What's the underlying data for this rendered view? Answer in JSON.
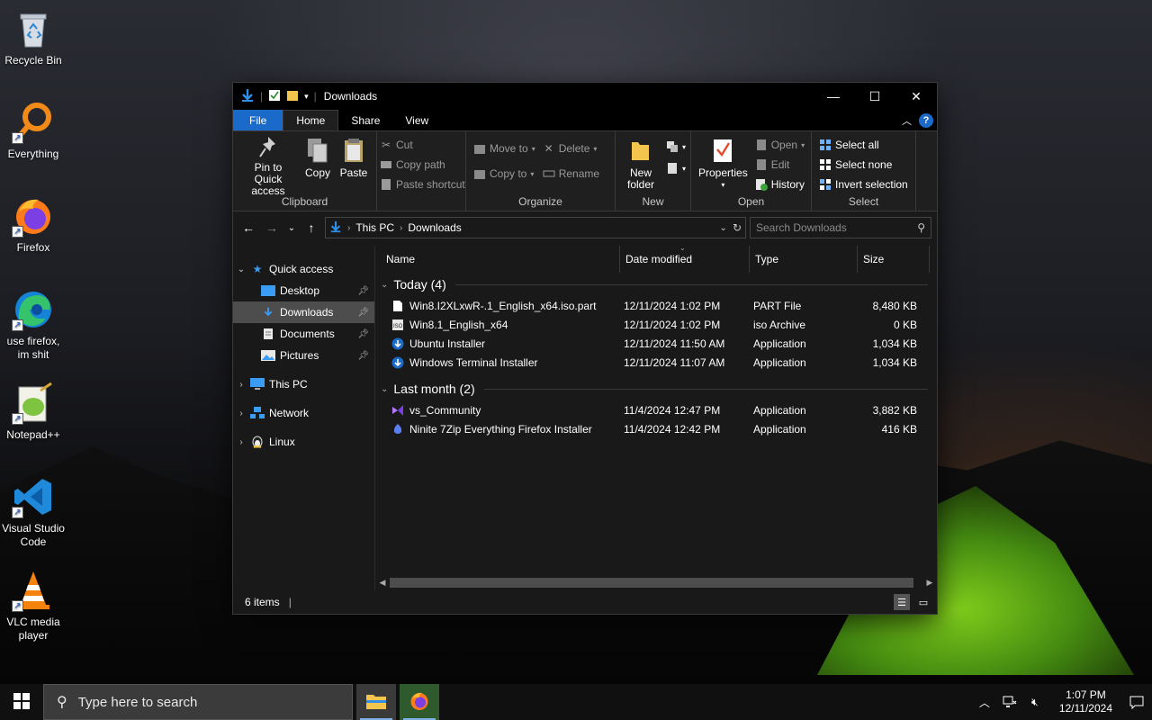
{
  "desktop": {
    "icons": [
      {
        "label": "Recycle Bin"
      },
      {
        "label": "Everything"
      },
      {
        "label": "Firefox"
      },
      {
        "label": "use firefox, im shit"
      },
      {
        "label": "Notepad++"
      },
      {
        "label": "Visual Studio Code"
      },
      {
        "label": "VLC media player"
      }
    ]
  },
  "window": {
    "title": "Downloads",
    "ribbon_tabs": [
      "File",
      "Home",
      "Share",
      "View"
    ],
    "ribbon": {
      "clipboard": {
        "label": "Clipboard",
        "pin": "Pin to Quick access",
        "copy": "Copy",
        "paste": "Paste",
        "cut": "Cut",
        "copy_path": "Copy path",
        "paste_shortcut": "Paste shortcut"
      },
      "organize": {
        "label": "Organize",
        "move_to": "Move to",
        "copy_to": "Copy to",
        "delete": "Delete",
        "rename": "Rename"
      },
      "new": {
        "label": "New",
        "new_folder": "New folder"
      },
      "open": {
        "label": "Open",
        "properties": "Properties",
        "open": "Open",
        "edit": "Edit",
        "history": "History"
      },
      "select": {
        "label": "Select",
        "select_all": "Select all",
        "select_none": "Select none",
        "invert": "Invert selection"
      }
    },
    "address": {
      "crumbs": [
        "This PC",
        "Downloads"
      ],
      "search_placeholder": "Search Downloads"
    },
    "nav": {
      "quick_access": "Quick access",
      "desktop": "Desktop",
      "downloads": "Downloads",
      "documents": "Documents",
      "pictures": "Pictures",
      "this_pc": "This PC",
      "network": "Network",
      "linux": "Linux"
    },
    "columns": [
      "Name",
      "Date modified",
      "Type",
      "Size"
    ],
    "groups": [
      {
        "title": "Today (4)",
        "files": [
          {
            "name": "Win8.I2XLxwR-.1_English_x64.iso.part",
            "date": "12/11/2024 1:02 PM",
            "type": "PART File",
            "size": "8,480 KB"
          },
          {
            "name": "Win8.1_English_x64",
            "date": "12/11/2024 1:02 PM",
            "type": "iso Archive",
            "size": "0 KB"
          },
          {
            "name": "Ubuntu Installer",
            "date": "12/11/2024 11:50 AM",
            "type": "Application",
            "size": "1,034 KB"
          },
          {
            "name": "Windows Terminal Installer",
            "date": "12/11/2024 11:07 AM",
            "type": "Application",
            "size": "1,034 KB"
          }
        ]
      },
      {
        "title": "Last month (2)",
        "files": [
          {
            "name": "vs_Community",
            "date": "11/4/2024 12:47 PM",
            "type": "Application",
            "size": "3,882 KB"
          },
          {
            "name": "Ninite 7Zip Everything Firefox Installer",
            "date": "11/4/2024 12:42 PM",
            "type": "Application",
            "size": "416 KB"
          }
        ]
      }
    ],
    "status": "6 items"
  },
  "taskbar": {
    "search_placeholder": "Type here to search",
    "time": "1:07 PM",
    "date": "12/11/2024"
  },
  "colors": {
    "accent": "#1a6ac9",
    "selection": "#4d4d4d"
  }
}
